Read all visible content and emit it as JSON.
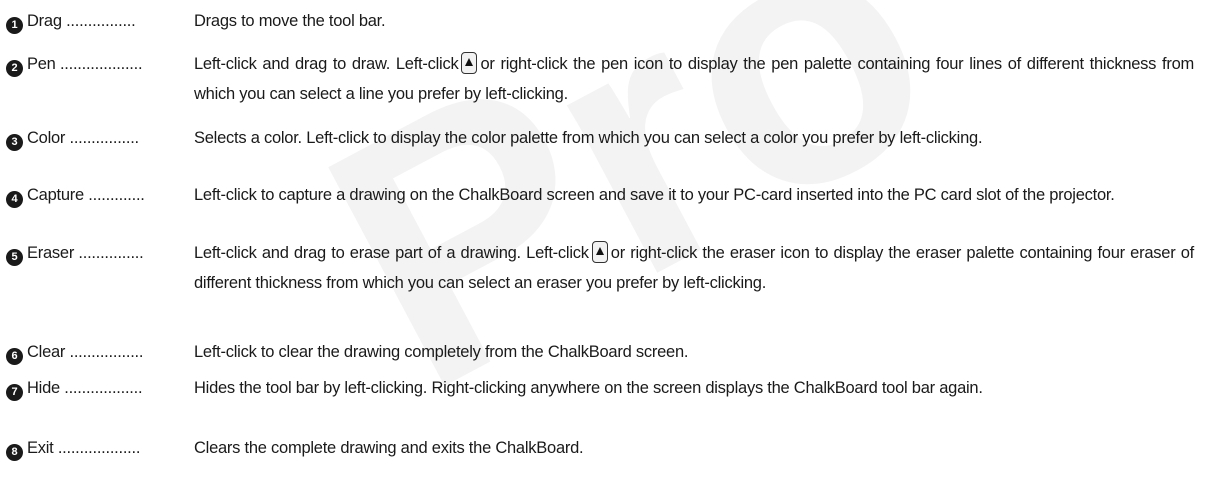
{
  "watermark": "Pro",
  "items": [
    {
      "num": "1",
      "term": "Drag ................",
      "desc": "Drags to move the tool bar."
    },
    {
      "num": "2",
      "term": "Pen ...................",
      "desc_a": "Left-click and drag to draw. Left-click",
      "desc_b": "or right-click the pen icon to display the pen palette containing four lines of different thickness from which you can select a line you prefer by left-clicking."
    },
    {
      "num": "3",
      "term": "Color ................",
      "desc": "Selects a color. Left-click to display the color palette from which you can select a color you prefer by left-clicking."
    },
    {
      "num": "4",
      "term": "Capture .............",
      "desc": "Left-click to capture a drawing on the ChalkBoard screen and save it to your PC-card inserted into the PC card slot of the projector."
    },
    {
      "num": "5",
      "term": "Eraser ...............",
      "desc_a": "Left-click and drag to erase part of a drawing. Left-click",
      "desc_b": "or right-click the eraser icon to display the eraser palette containing four eraser of different thickness from which you can select an eraser you prefer by left-clicking."
    },
    {
      "num": "6",
      "term": "Clear .................",
      "desc": "Left-click to clear the drawing completely from the ChalkBoard screen."
    },
    {
      "num": "7",
      "term": "Hide ..................",
      "desc": "Hides the tool bar by left-clicking. Right-clicking anywhere on the screen displays the ChalkBoard tool bar again."
    },
    {
      "num": "8",
      "term": "Exit ...................",
      "desc": "Clears the complete drawing and exits the ChalkBoard."
    }
  ],
  "icons": {
    "dropdown": "triangle-button-icon"
  }
}
